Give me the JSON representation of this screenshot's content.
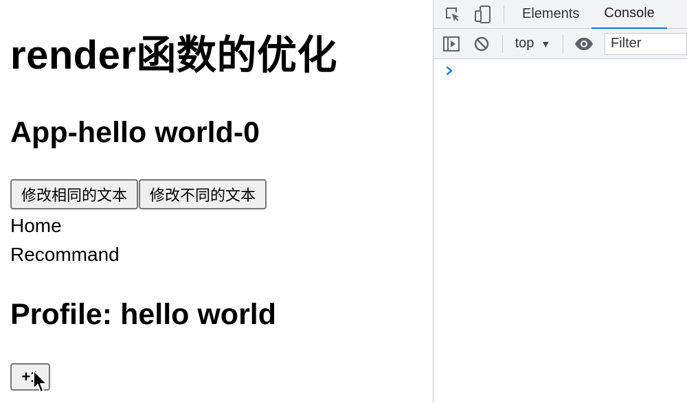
{
  "page": {
    "title": "render函数的优化",
    "app_heading": "App-hello world-0",
    "buttons": {
      "same_text": "修改相同的文本",
      "diff_text": "修改不同的文本"
    },
    "nav": [
      "Home",
      "Recommand"
    ],
    "profile_heading": "Profile: hello world",
    "plus_label": "+1"
  },
  "devtools": {
    "tabs": [
      {
        "label": "Elements",
        "active": false
      },
      {
        "label": "Console",
        "active": true
      }
    ],
    "context": "top",
    "filter_placeholder": "Filter",
    "accent_color": "#1a73e8"
  }
}
